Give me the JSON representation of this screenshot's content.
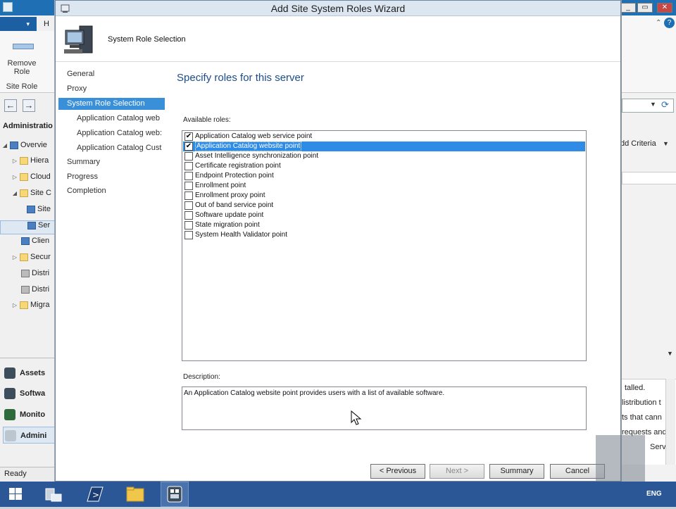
{
  "wizard": {
    "title": "Add Site System Roles Wizard",
    "header_title": "System Role Selection",
    "page_title": "Specify roles for this server",
    "available_roles_label": "Available roles:",
    "description_label": "Description:",
    "description_text": "An Application Catalog website point provides users with a list of available software.",
    "nav": [
      {
        "label": "General",
        "level": 0,
        "active": false
      },
      {
        "label": "Proxy",
        "level": 0,
        "active": false
      },
      {
        "label": "System Role Selection",
        "level": 0,
        "active": true
      },
      {
        "label": "Application Catalog web",
        "level": 1,
        "active": false
      },
      {
        "label": "Application Catalog web:",
        "level": 1,
        "active": false
      },
      {
        "label": "Application Catalog Cust",
        "level": 1,
        "active": false
      },
      {
        "label": "Summary",
        "level": 0,
        "active": false
      },
      {
        "label": "Progress",
        "level": 0,
        "active": false
      },
      {
        "label": "Completion",
        "level": 0,
        "active": false
      }
    ],
    "roles": [
      {
        "label": "Application Catalog web service point",
        "checked": true,
        "selected": false
      },
      {
        "label": "Application Catalog website point",
        "checked": true,
        "selected": true
      },
      {
        "label": "Asset Intelligence synchronization point",
        "checked": false,
        "selected": false
      },
      {
        "label": "Certificate registration point",
        "checked": false,
        "selected": false
      },
      {
        "label": "Endpoint Protection point",
        "checked": false,
        "selected": false
      },
      {
        "label": "Enrollment point",
        "checked": false,
        "selected": false
      },
      {
        "label": "Enrollment proxy point",
        "checked": false,
        "selected": false
      },
      {
        "label": "Out of band service point",
        "checked": false,
        "selected": false
      },
      {
        "label": "Software update point",
        "checked": false,
        "selected": false
      },
      {
        "label": "State migration point",
        "checked": false,
        "selected": false
      },
      {
        "label": "System Health Validator point",
        "checked": false,
        "selected": false
      }
    ],
    "buttons": {
      "previous": "< Previous",
      "next": "Next >",
      "summary": "Summary",
      "cancel": "Cancel"
    }
  },
  "background_left": {
    "home_tab": "H",
    "remove_role": "Remove Role",
    "site_role": "Site Role",
    "workspace_label": "Administratio",
    "tree": [
      "Overvie",
      "Hiera",
      "Cloud",
      "Site C",
      "Site",
      "Ser",
      "Clien",
      "Secur",
      "Distri",
      "Distri",
      "Migra"
    ],
    "workspaces": [
      "Assets",
      "Softwa",
      "Monito",
      "Admini"
    ],
    "status": "Ready"
  },
  "background_right": {
    "add_criteria": "dd Criteria",
    "lines": [
      "talled.",
      "listribution t",
      "ts that cann",
      "requests and",
      "Serv"
    ]
  },
  "taskbar": {
    "language": "ENG"
  },
  "colors": {
    "accent": "#3a8fd9",
    "selection": "#2e8be6",
    "taskbar": "#2b5797",
    "title_text": "#1c4d8a"
  }
}
